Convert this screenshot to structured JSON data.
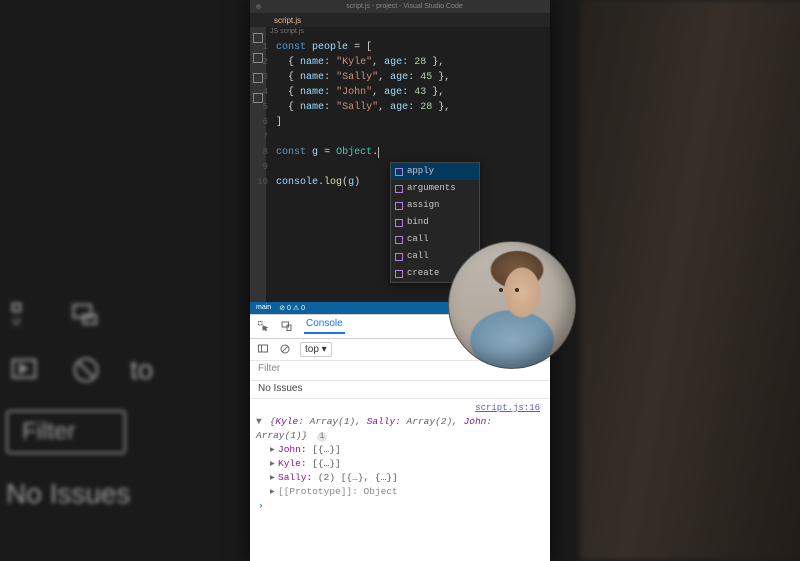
{
  "editor": {
    "window_title": "script.js - project - Visual Studio Code",
    "tab": "script.js",
    "breadcrumb": "JS script.js",
    "code_line_current": "const g = Object.",
    "log_line": "console.log(g)",
    "people": [
      {
        "name": "Kyle",
        "age": 28
      },
      {
        "name": "Sally",
        "age": 45
      },
      {
        "name": "John",
        "age": 43
      },
      {
        "name": "Sally",
        "age": 28
      }
    ],
    "suggestions": [
      "apply",
      "arguments",
      "assign",
      "bind",
      "call",
      "call",
      "create"
    ],
    "statusbar": {
      "branch": "main",
      "errors": "0",
      "warnings": "0"
    }
  },
  "devtools": {
    "tabs": {
      "console": "Console"
    },
    "context": "top",
    "filter_placeholder": "Filter",
    "issues_text": "No Issues",
    "source_link": "script.js:16",
    "summary": "{Kyle: Array(1), Sally: Array(2), John: Array(1)}",
    "entries": [
      {
        "key": "John",
        "preview": "[{…}]"
      },
      {
        "key": "Kyle",
        "preview": "[{…}]"
      },
      {
        "key": "Sally",
        "preview": "(2) [{…}, {…}]"
      }
    ],
    "prototype": "[[Prototype]]: Object",
    "prompt": "›"
  },
  "bg_ghost": {
    "filter": "Filter",
    "noissues": "No Issues",
    "to": "to"
  }
}
